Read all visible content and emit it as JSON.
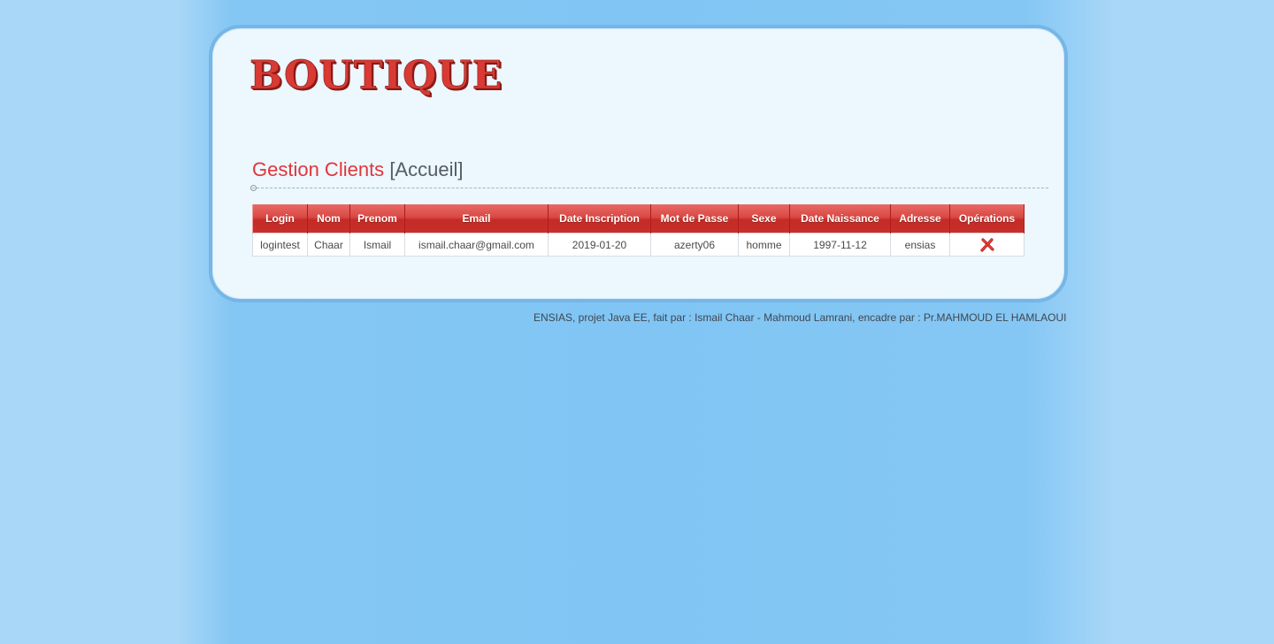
{
  "logo": {
    "text": "BOUTIQUE"
  },
  "heading": {
    "title": "Gestion Clients",
    "context": "[Accueil]"
  },
  "table": {
    "columns": [
      "Login",
      "Nom",
      "Prenom",
      "Email",
      "Date Inscription",
      "Mot de Passe",
      "Sexe",
      "Date Naissance",
      "Adresse",
      "Opérations"
    ],
    "rows": [
      {
        "login": "logintest",
        "nom": "Chaar",
        "prenom": "Ismail",
        "email": "ismail.chaar@gmail.com",
        "date_inscription": "2019-01-20",
        "mot_de_passe": "azerty06",
        "sexe": "homme",
        "date_naissance": "1997-11-12",
        "adresse": "ensias",
        "operation_icon": "delete-icon"
      }
    ]
  },
  "footer": {
    "text": "ENSIAS, projet Java EE, fait par : Ismail Chaar - Mahmoud Lamrani, encadre par : Pr.MAHMOUD EL HAMLAOUI"
  },
  "colors": {
    "accent": "#e0363a",
    "header_red": "#c92f2a",
    "page_blue": "#80c5f4",
    "panel_bg": "#ecf7fe",
    "panel_border": "#76b6e6"
  }
}
